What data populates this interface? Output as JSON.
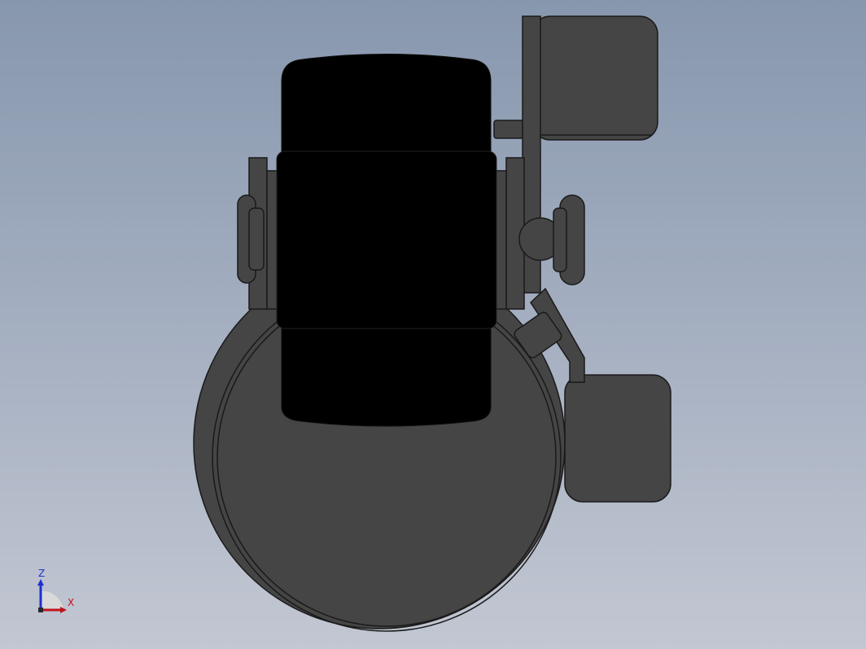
{
  "viewport": {
    "background_top": "#8797ae",
    "background_bottom": "#c2c7d2"
  },
  "model": {
    "part_color": "#454545",
    "edge_color": "#1a1a1a",
    "wheel_color": "#000000"
  },
  "triad": {
    "z_label": "Z",
    "x_label": "X",
    "z_color": "#1f2fd0",
    "x_color": "#c0141e"
  }
}
